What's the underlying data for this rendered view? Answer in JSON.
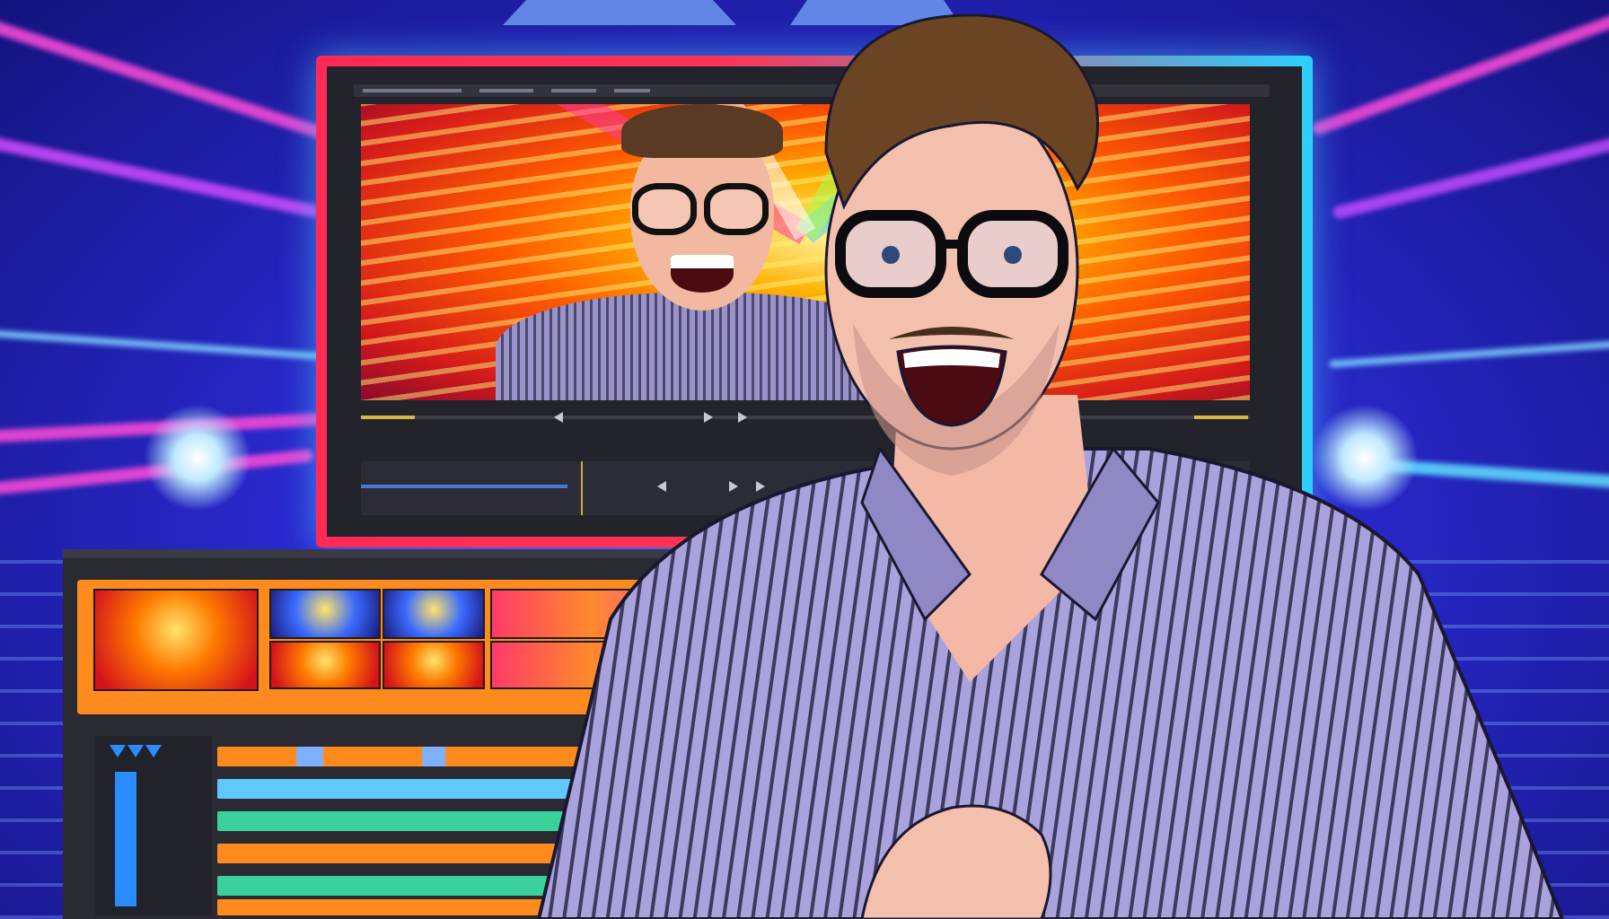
{
  "scene": {
    "description_tag": "",
    "colors": {
      "background_blue": "#2b2bd6",
      "ray_pink": "#ff4ad8",
      "ray_cyan": "#5fe0ff",
      "monitor_frame_left": "#ff2a55",
      "monitor_frame_right": "#2ad0ff",
      "editor_orange": "#ff8a1e",
      "shirt_stripe": "#9a92c8",
      "hair": "#5a3a22"
    },
    "icons": {
      "play": "play-icon",
      "rewind": "rewind-icon",
      "forward": "forward-icon",
      "track_marker": "marker-icon"
    }
  }
}
